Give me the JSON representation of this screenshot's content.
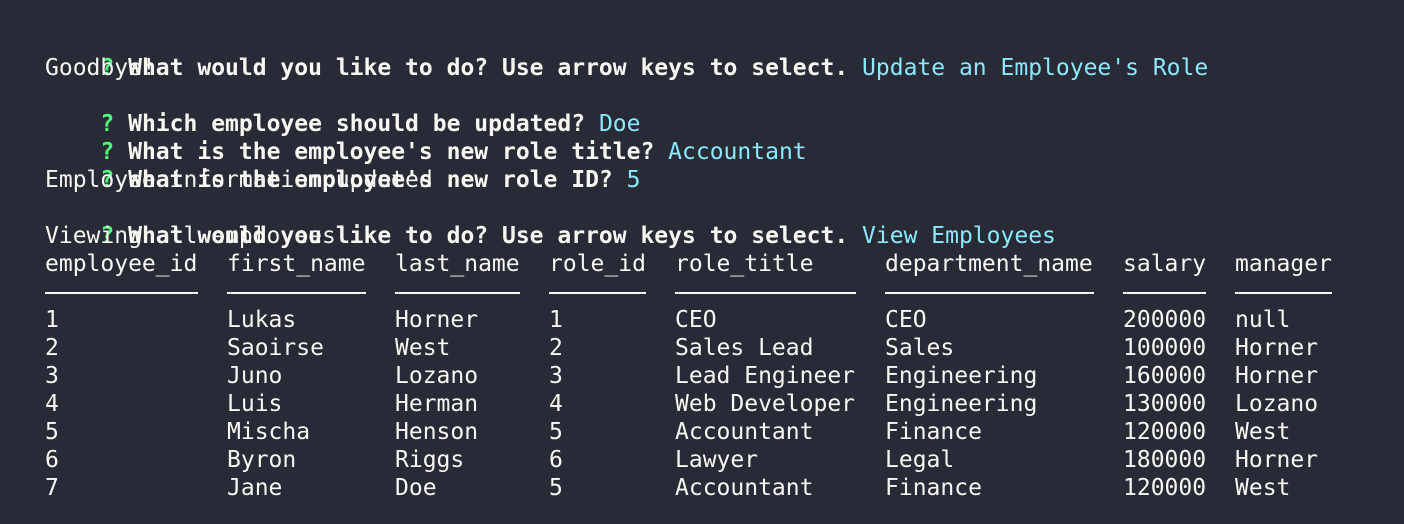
{
  "session": {
    "q_mark": "?",
    "lines": [
      {
        "type": "qa",
        "prompt": "What would you like to do? Use arrow keys to select.",
        "answer": "Update an Employee's Role"
      },
      {
        "type": "text",
        "text": "Goodbye!"
      },
      {
        "type": "qa",
        "prompt": "Which employee should be updated?",
        "answer": "Doe"
      },
      {
        "type": "qa",
        "prompt": "What is the employee's new role title?",
        "answer": "Accountant"
      },
      {
        "type": "qa",
        "prompt": "What is the employee's new role ID?",
        "answer": "5"
      },
      {
        "type": "text",
        "text": "Employee information updated"
      },
      {
        "type": "qa",
        "prompt": "What would you like to do? Use arrow keys to select.",
        "answer": "View Employees"
      },
      {
        "type": "text",
        "text": "Viewing all employees"
      }
    ]
  },
  "table": {
    "columns": [
      "employee_id",
      "first_name",
      "last_name",
      "role_id",
      "role_title",
      "department_name",
      "salary",
      "manager"
    ],
    "rows": [
      [
        "1",
        "Lukas",
        "Horner",
        "1",
        "CEO",
        "CEO",
        "200000",
        "null"
      ],
      [
        "2",
        "Saoirse",
        "West",
        "2",
        "Sales Lead",
        "Sales",
        "100000",
        "Horner"
      ],
      [
        "3",
        "Juno",
        "Lozano",
        "3",
        "Lead Engineer",
        "Engineering",
        "160000",
        "Horner"
      ],
      [
        "4",
        "Luis",
        "Herman",
        "4",
        "Web Developer",
        "Engineering",
        "130000",
        "Lozano"
      ],
      [
        "5",
        "Mischa",
        "Henson",
        "5",
        "Accountant",
        "Finance",
        "120000",
        "West"
      ],
      [
        "6",
        "Byron",
        "Riggs",
        "6",
        "Lawyer",
        "Legal",
        "180000",
        "Horner"
      ],
      [
        "7",
        "Jane",
        "Doe",
        "5",
        "Accountant",
        "Finance",
        "120000",
        "West"
      ]
    ]
  },
  "colors": {
    "background": "#282a36",
    "text": "#f8f8f2",
    "question_mark": "#50fa7b",
    "answer": "#8be9fd"
  }
}
